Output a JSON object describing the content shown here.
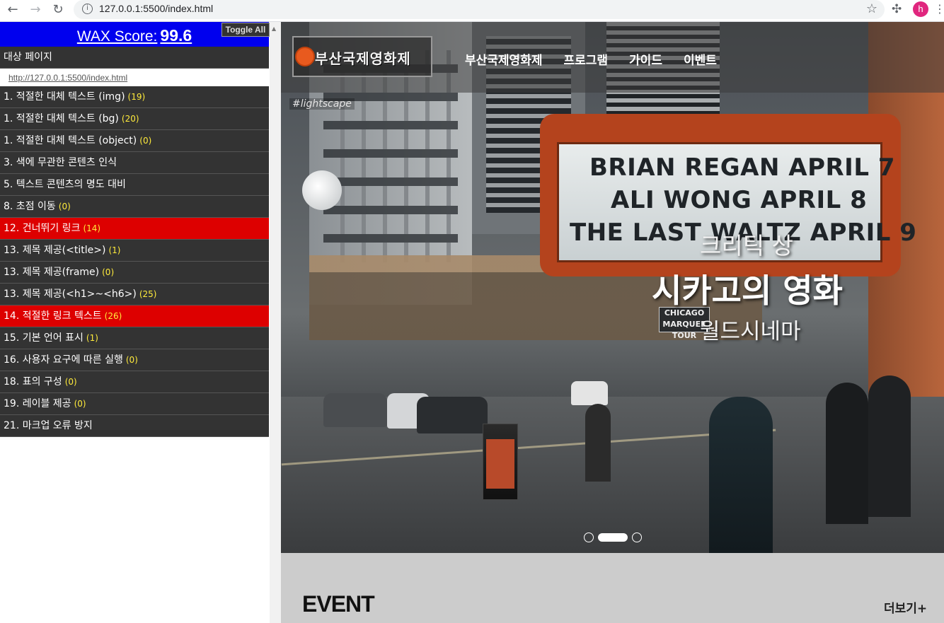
{
  "browser": {
    "url": "127.0.0.1:5500/index.html",
    "avatar_letter": "h",
    "icons": [
      "back-icon",
      "forward-icon",
      "reload-icon",
      "info-icon",
      "star-icon",
      "extensions-icon",
      "menu-icon"
    ]
  },
  "wax": {
    "score_label": "WAX Score:",
    "score_value": "99.6",
    "toggle_label": "Toggle All",
    "target_label": "대상 페이지",
    "target_url": "http://127.0.0.1:5500/index.html",
    "items": [
      {
        "label": "1. 적절한 대체 텍스트 (img)",
        "count": "(19)",
        "status": "pass"
      },
      {
        "label": "1. 적절한 대체 텍스트 (bg)",
        "count": "(20)",
        "status": "pass"
      },
      {
        "label": "1. 적절한 대체 텍스트 (object)",
        "count": "(0)",
        "status": "pass"
      },
      {
        "label": "3. 색에 무관한 콘텐츠 인식",
        "count": "",
        "status": "pass"
      },
      {
        "label": "5. 텍스트 콘텐츠의 명도 대비",
        "count": "",
        "status": "pass"
      },
      {
        "label": "8. 초점 이동",
        "count": "(0)",
        "status": "pass"
      },
      {
        "label": "12. 건너뛰기 링크",
        "count": "(14)",
        "status": "fail"
      },
      {
        "label": "13. 제목 제공(<title>)",
        "count": "(1)",
        "status": "pass"
      },
      {
        "label": "13. 제목 제공(frame)",
        "count": "(0)",
        "status": "pass"
      },
      {
        "label": "13. 제목 제공(<h1>~<h6>)",
        "count": "(25)",
        "status": "pass"
      },
      {
        "label": "14. 적절한 링크 텍스트",
        "count": "(26)",
        "status": "fail"
      },
      {
        "label": "15. 기본 언어 표시",
        "count": "(1)",
        "status": "pass"
      },
      {
        "label": "16. 사용자 요구에 따른 실행",
        "count": "(0)",
        "status": "pass"
      },
      {
        "label": "18. 표의 구성",
        "count": "(0)",
        "status": "pass"
      },
      {
        "label": "19. 레이블 제공",
        "count": "(0)",
        "status": "pass"
      },
      {
        "label": "21. 마크업 오류 방지",
        "count": "",
        "status": "pass"
      }
    ]
  },
  "site": {
    "logo_text": "부산국제영화제",
    "nav": [
      "부산국제영화제",
      "프로그램",
      "가이드",
      "이벤트"
    ],
    "hero": {
      "award": "크리틱 상",
      "title": "시카고의 영화",
      "distributor": "월드시네마",
      "photo_tag": "#lightscape",
      "marquee_lines": [
        "BRIAN REGAN APRIL 7",
        "ALI WONG APRIL 8",
        "THE LAST WALTZ APRIL 9"
      ],
      "chicago_sign": "CHICAGO\nMARQUEE TOUR"
    },
    "pager": {
      "count": 3,
      "active_index": 1
    },
    "event": {
      "title": "EVENT",
      "more": "더보기+"
    }
  },
  "colors": {
    "wax_header": "#0000ee",
    "wax_item_bg": "#333333",
    "wax_fail": "#dd0000",
    "wax_count": "#ffeb3b",
    "event_bg": "#cccccc"
  }
}
